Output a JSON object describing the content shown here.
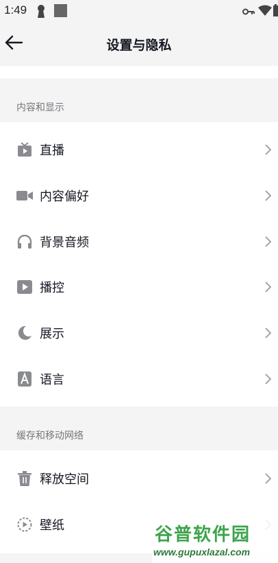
{
  "status_bar": {
    "time": "1:49",
    "left_icons": [
      "keyhole-icon",
      "square-notification-icon"
    ],
    "right_icons": [
      "vpn-key-icon",
      "wifi-icon",
      "battery-icon"
    ]
  },
  "header": {
    "back_icon": "arrow-left-icon",
    "title": "设置与隐私"
  },
  "sections": [
    {
      "title": "内容和显示",
      "items": [
        {
          "label": "直播",
          "icon": "tv-icon"
        },
        {
          "label": "内容偏好",
          "icon": "video-camera-icon"
        },
        {
          "label": "背景音频",
          "icon": "headphones-icon"
        },
        {
          "label": "播控",
          "icon": "play-square-icon"
        },
        {
          "label": "展示",
          "icon": "moon-icon"
        },
        {
          "label": "语言",
          "icon": "letter-a-icon"
        }
      ]
    },
    {
      "title": "缓存和移动网络",
      "items": [
        {
          "label": "释放空间",
          "icon": "trash-icon"
        },
        {
          "label": "壁纸",
          "icon": "play-circle-dashed-icon"
        }
      ]
    }
  ],
  "watermark": {
    "title": "谷普软件园",
    "url": "www.gupuxlazal.com"
  },
  "colors": {
    "background": "#f4f4f4",
    "card": "#ffffff",
    "icon": "#8a8b90",
    "text": "#161823",
    "section_text": "#75767c"
  }
}
